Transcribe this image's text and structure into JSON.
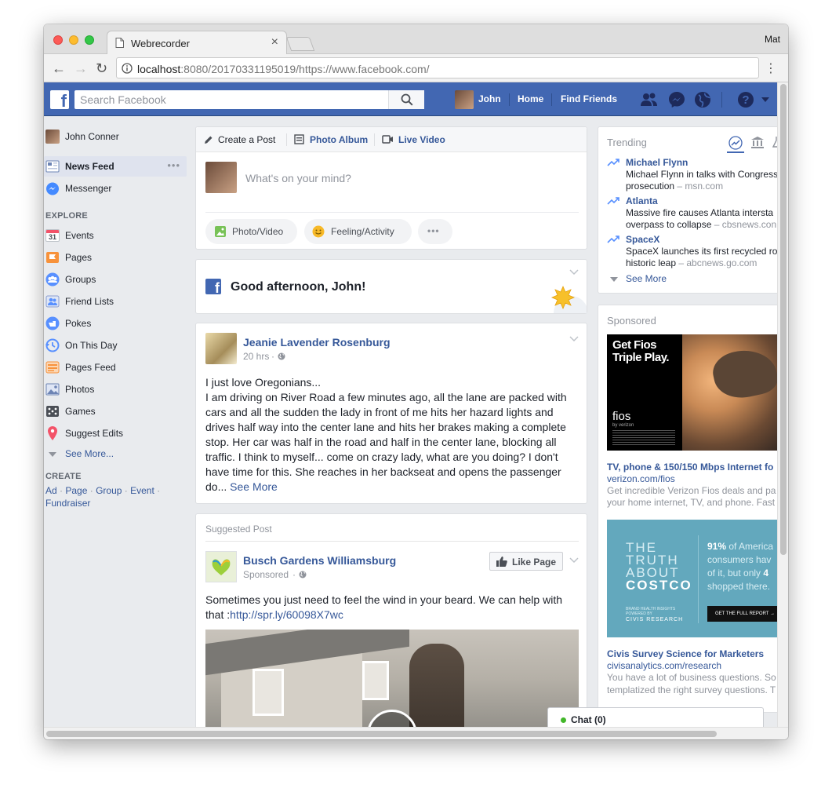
{
  "browser": {
    "tab_title": "Webrecorder",
    "profile": "Mat",
    "url_host": "localhost",
    "url_rest": ":8080/20170331195019/https://www.facebook.com/"
  },
  "fb": {
    "search_placeholder": "Search Facebook",
    "user": "John",
    "home": "Home",
    "find_friends": "Find Friends"
  },
  "left": {
    "profile_name": "John Conner",
    "news_feed": "News Feed",
    "messenger": "Messenger",
    "explore_heading": "EXPLORE",
    "explore": [
      {
        "label": "Events",
        "color": "#ffffff"
      },
      {
        "label": "Pages",
        "color": "#f7923b"
      },
      {
        "label": "Groups",
        "color": "#5890ff"
      },
      {
        "label": "Friend Lists",
        "color": "#5890ff"
      },
      {
        "label": "Pokes",
        "color": "#5890ff"
      },
      {
        "label": "On This Day",
        "color": "#5890ff"
      },
      {
        "label": "Pages Feed",
        "color": "#f7923b"
      },
      {
        "label": "Photos",
        "color": "#6d84b4"
      },
      {
        "label": "Games",
        "color": "#4b4f56"
      },
      {
        "label": "Suggest Edits",
        "color": "#f35369"
      }
    ],
    "events_day": "31",
    "see_more": "See More...",
    "create_heading": "CREATE",
    "create_links": [
      "Ad",
      "Page",
      "Group",
      "Event"
    ],
    "fundraiser": "Fundraiser"
  },
  "composer": {
    "tab_create": "Create a Post",
    "tab_album": "Photo Album",
    "tab_live": "Live Video",
    "placeholder": "What's on your mind?",
    "btn_photo": "Photo/Video",
    "btn_feeling": "Feeling/Activity",
    "btn_more": "•••"
  },
  "greeting": {
    "text": "Good afternoon, John!"
  },
  "post1": {
    "author": "Jeanie Lavender Rosenburg",
    "time": "20 hrs",
    "line1": "I just love Oregonians...",
    "body": "I am driving on River Road a few minutes ago, all the lane are packed with cars and all the sudden the lady in front of me hits her hazard lights and drives half way into the center lane and hits her brakes making a complete stop. Her car was half in the road and half in the center lane, blocking all traffic. I think to myself... come on crazy lady, what are you doing? I don't have time for this. She reaches in her backseat and opens the passenger do...",
    "see_more": "See More"
  },
  "post2": {
    "label": "Suggested Post",
    "author": "Busch Gardens Williamsburg",
    "sponsored": "Sponsored",
    "like_page": "Like Page",
    "text": "Sometimes you just need to feel the wind in your beard. We can help with that :",
    "link": "http://spr.ly/60098X7wc"
  },
  "trending": {
    "heading": "Trending",
    "items": [
      {
        "title": "Michael Flynn",
        "desc": "Michael Flynn in talks with Congress",
        "desc2": "prosecution",
        "source": "msn.com"
      },
      {
        "title": "Atlanta",
        "desc": "Massive fire causes Atlanta intersta",
        "desc2": "overpass to collapse",
        "source": "cbsnews.con"
      },
      {
        "title": "SpaceX",
        "desc": "SpaceX launches its first recycled ro",
        "desc2": "historic leap",
        "source": "abcnews.go.com"
      }
    ],
    "see_more": "See More"
  },
  "sponsored": {
    "heading": "Sponsored",
    "ad1_img_line1": "Get Fios",
    "ad1_img_line2": "Triple Play.",
    "ad1_brand": "fios",
    "ad1_brand_sub": "by verizon",
    "ad1_title": "TV, phone & 150/150 Mbps Internet fo",
    "ad1_url": "verizon.com/fios",
    "ad1_desc": "Get incredible Verizon Fios deals and pa",
    "ad1_desc2": "your home internet, TV, and phone. Fast",
    "ad2_img_1": "THE",
    "ad2_img_2": "TRUTH",
    "ad2_img_3": "ABOUT",
    "ad2_img_4": "COSTCO",
    "ad2_img_right1a": "91%",
    "ad2_img_right1b": " of America",
    "ad2_img_right2": "consumers hav",
    "ad2_img_right3a": "of it, but only ",
    "ad2_img_right3b": "4",
    "ad2_img_right4": "shopped there.",
    "ad2_small": "BRAND HEALTH INSIGHTS POWERED BY",
    "ad2_civis": "CIVIS RESEARCH",
    "ad2_cta": "GET THE FULL REPORT →",
    "ad2_title": "Civis Survey Science for Marketers",
    "ad2_url": "civisanalytics.com/research",
    "ad2_desc": "You have a lot of business questions. So",
    "ad2_desc2": "templatized the right survey questions. T"
  },
  "chat": {
    "label": "Chat (0)"
  }
}
